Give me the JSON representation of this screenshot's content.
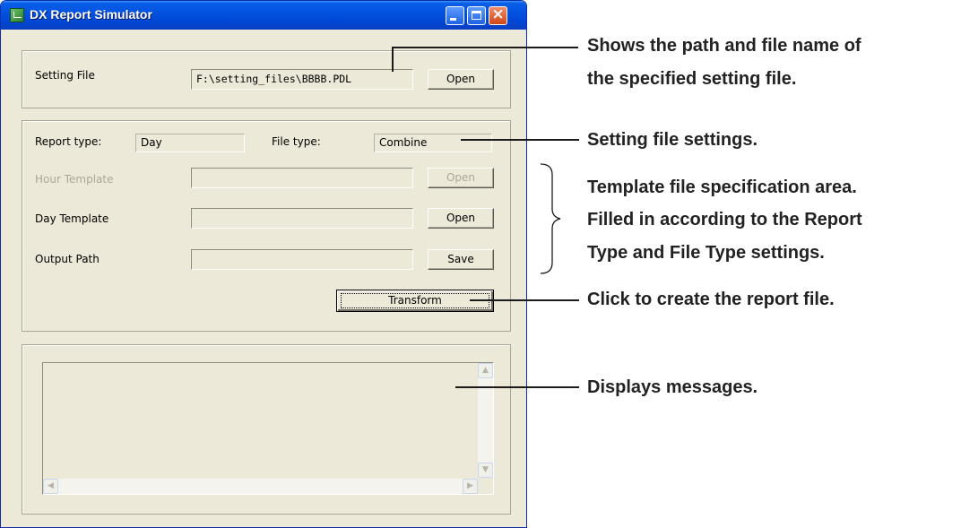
{
  "window": {
    "title": "DX Report Simulator"
  },
  "setting_file": {
    "label": "Setting File",
    "path": "F:\\setting_files\\BBBB.PDL",
    "open_label": "Open"
  },
  "settings": {
    "report_type_label": "Report type:",
    "report_type_value": "Day",
    "file_type_label": "File type:",
    "file_type_value": "Combine"
  },
  "templates": {
    "hour_label": "Hour Template",
    "hour_value": "",
    "hour_open_label": "Open",
    "day_label": "Day Template",
    "day_value": "",
    "day_open_label": "Open",
    "output_label": "Output Path",
    "output_value": "",
    "save_label": "Save",
    "transform_label": "Transform"
  },
  "messages": {
    "content": ""
  },
  "annotations": {
    "setting_file_line1": "Shows the path and file name of",
    "setting_file_line2": "the specified setting file.",
    "settings": "Setting file settings.",
    "template_line1": "Template file specification area.",
    "template_line2": "Filled in according to the Report",
    "template_line3": "Type and File Type settings.",
    "transform": "Click to create the report file.",
    "messages": "Displays messages."
  }
}
